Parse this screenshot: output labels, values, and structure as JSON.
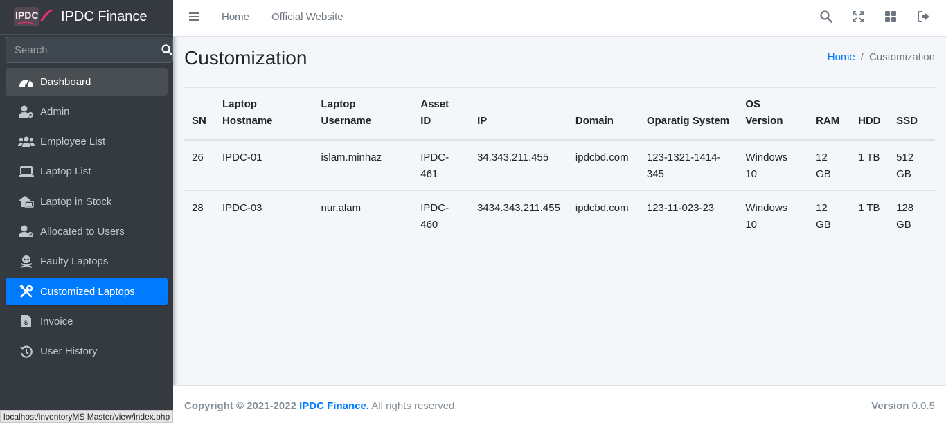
{
  "brand": {
    "logo_text": "IPDC",
    "name": "IPDC Finance"
  },
  "search": {
    "placeholder": "Search"
  },
  "sidebar": {
    "items": [
      {
        "label": "Dashboard",
        "icon": "tachometer-icon"
      },
      {
        "label": "Admin",
        "icon": "user-gear-icon"
      },
      {
        "label": "Employee List",
        "icon": "users-icon"
      },
      {
        "label": "Laptop List",
        "icon": "laptop-icon"
      },
      {
        "label": "Laptop in Stock",
        "icon": "warehouse-icon"
      },
      {
        "label": "Allocated to Users",
        "icon": "user-check-icon"
      },
      {
        "label": "Faulty Laptops",
        "icon": "skull-crossbones-icon"
      },
      {
        "label": "Customized Laptops",
        "icon": "tools-icon"
      },
      {
        "label": "Invoice",
        "icon": "invoice-icon"
      },
      {
        "label": "User History",
        "icon": "history-icon"
      }
    ]
  },
  "topbar": {
    "home": "Home",
    "website": "Official Website"
  },
  "page": {
    "title": "Customization"
  },
  "breadcrumb": {
    "home": "Home",
    "sep": "/",
    "current": "Customization"
  },
  "table": {
    "headers": [
      "SN",
      "Laptop Hostname",
      "Laptop Username",
      "Asset ID",
      "IP",
      "Domain",
      "Oparatig System",
      "OS Version",
      "RAM",
      "HDD",
      "SSD"
    ],
    "rows": [
      [
        "26",
        "IPDC-01",
        "islam.minhaz",
        "IPDC-461",
        "34.343.211.455",
        "ipdcbd.com",
        "123-1321-1414-345",
        "Windows 10",
        "12 GB",
        "1 TB",
        "512 GB"
      ],
      [
        "28",
        "IPDC-03",
        "nur.alam",
        "IPDC-460",
        "3434.343.211.455",
        "ipdcbd.com",
        "123-11-023-23",
        "Windows 10",
        "12 GB",
        "1 TB",
        "128 GB"
      ]
    ]
  },
  "footer": {
    "copyright": "Copyright © 2021-2022",
    "brand": "IPDC Finance.",
    "rights": "All rights reserved.",
    "version_label": "Version",
    "version": "0.0.5"
  },
  "status_url": "localhost/inventoryMS Master/view/index.php",
  "colors": {
    "sidebar": "#343a40",
    "accent": "#007bff",
    "brand_pink": "#d6336c"
  }
}
